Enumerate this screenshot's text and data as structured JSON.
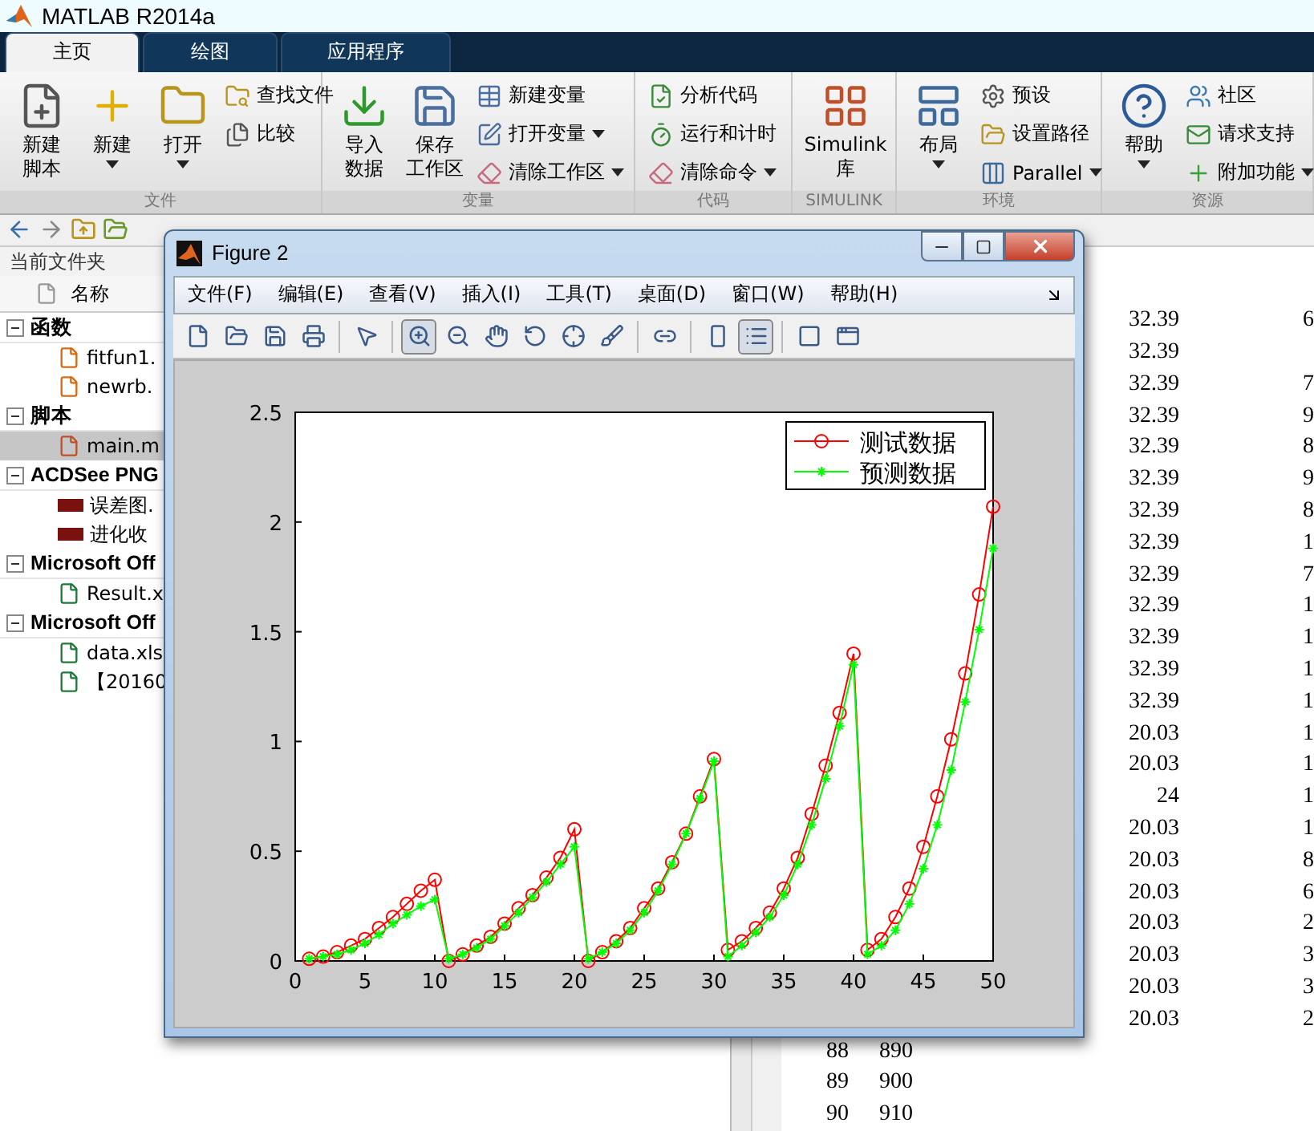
{
  "window": {
    "title": "MATLAB R2014a"
  },
  "tabs": [
    {
      "label": "主页",
      "selected": true
    },
    {
      "label": "绘图",
      "selected": false
    },
    {
      "label": "应用程序",
      "selected": false
    }
  ],
  "ribbon": [
    {
      "label": "文件",
      "items": [
        {
          "kind": "large",
          "lines": [
            "新建",
            "脚本"
          ],
          "dropdown": false
        },
        {
          "kind": "large",
          "lines": [
            "新建"
          ],
          "dropdown": true
        },
        {
          "kind": "large",
          "lines": [
            "打开"
          ],
          "dropdown": true
        },
        {
          "kind": "small",
          "label": "查找文件",
          "dropdown": false
        },
        {
          "kind": "small",
          "label": "比较",
          "dropdown": false
        }
      ]
    },
    {
      "label": "变量",
      "items": [
        {
          "kind": "large",
          "lines": [
            "导入",
            "数据"
          ],
          "dropdown": false
        },
        {
          "kind": "large",
          "lines": [
            "保存",
            "工作区"
          ],
          "dropdown": false
        },
        {
          "kind": "small",
          "label": "新建变量",
          "dropdown": false
        },
        {
          "kind": "small",
          "label": "打开变量",
          "dropdown": true
        },
        {
          "kind": "small",
          "label": "清除工作区",
          "dropdown": true
        }
      ]
    },
    {
      "label": "代码",
      "items": [
        {
          "kind": "small",
          "label": "分析代码",
          "dropdown": false
        },
        {
          "kind": "small",
          "label": "运行和计时",
          "dropdown": false
        },
        {
          "kind": "small",
          "label": "清除命令",
          "dropdown": true
        }
      ]
    },
    {
      "label": "SIMULINK",
      "items": [
        {
          "kind": "large",
          "lines": [
            "Simulink",
            "库"
          ],
          "dropdown": false
        }
      ]
    },
    {
      "label": "环境",
      "items": [
        {
          "kind": "large",
          "lines": [
            "布局"
          ],
          "dropdown": true
        },
        {
          "kind": "small",
          "label": "预设",
          "dropdown": false
        },
        {
          "kind": "small",
          "label": "设置路径",
          "dropdown": false
        },
        {
          "kind": "small",
          "label": "Parallel",
          "dropdown": true
        }
      ]
    },
    {
      "label": "资源",
      "items": [
        {
          "kind": "large",
          "lines": [
            "帮助"
          ],
          "dropdown": true
        },
        {
          "kind": "small",
          "label": "社区",
          "dropdown": false
        },
        {
          "kind": "small",
          "label": "请求支持",
          "dropdown": false
        },
        {
          "kind": "small",
          "label": "附加功能",
          "dropdown": true
        }
      ]
    }
  ],
  "browser": {
    "title": "当前文件夹",
    "column": "名称",
    "groups": [
      {
        "label": "函数",
        "expanded": true,
        "files": [
          {
            "name": "fitfun1.",
            "kind": "function",
            "selected": false
          },
          {
            "name": "newrb.",
            "kind": "function",
            "selected": false
          }
        ]
      },
      {
        "label": "脚本",
        "expanded": true,
        "files": [
          {
            "name": "main.m",
            "kind": "script",
            "selected": true
          }
        ]
      },
      {
        "label": "ACDSee PNG",
        "expanded": true,
        "files": [
          {
            "name": "误差图.",
            "kind": "png",
            "selected": false
          },
          {
            "name": "进化收",
            "kind": "png",
            "selected": false
          }
        ]
      },
      {
        "label": "Microsoft Off",
        "expanded": true,
        "files": [
          {
            "name": "Result.x",
            "kind": "excel",
            "selected": false
          }
        ]
      },
      {
        "label": "Microsoft Off",
        "expanded": true,
        "files": [
          {
            "name": "data.xls",
            "kind": "excel",
            "selected": false
          },
          {
            "name": "【20160",
            "kind": "excel",
            "selected": false
          }
        ]
      }
    ]
  },
  "table": {
    "rows": [
      {
        "cells": [
          null,
          null,
          "32.39",
          "6"
        ]
      },
      {
        "cells": [
          null,
          null,
          "32.39",
          null
        ]
      },
      {
        "cells": [
          null,
          null,
          "32.39",
          "7"
        ]
      },
      {
        "cells": [
          null,
          null,
          "32.39",
          "9"
        ]
      },
      {
        "cells": [
          null,
          null,
          "32.39",
          "8"
        ]
      },
      {
        "cells": [
          null,
          null,
          "32.39",
          "9"
        ]
      },
      {
        "cells": [
          null,
          null,
          "32.39",
          "8"
        ]
      },
      {
        "cells": [
          null,
          null,
          "32.39",
          "1"
        ]
      },
      {
        "cells": [
          null,
          null,
          "32.39",
          "7"
        ]
      },
      {
        "cells": [
          null,
          null,
          "32.39",
          "1"
        ]
      },
      {
        "cells": [
          null,
          null,
          "32.39",
          "1"
        ]
      },
      {
        "cells": [
          null,
          null,
          "32.39",
          "1"
        ]
      },
      {
        "cells": [
          null,
          null,
          "32.39",
          "1"
        ]
      },
      {
        "cells": [
          null,
          null,
          "20.03",
          "1"
        ]
      },
      {
        "cells": [
          null,
          null,
          "20.03",
          "1"
        ]
      },
      {
        "cells": [
          null,
          null,
          "24",
          "1"
        ]
      },
      {
        "cells": [
          null,
          null,
          "20.03",
          "1"
        ]
      },
      {
        "cells": [
          null,
          null,
          "20.03",
          "8"
        ]
      },
      {
        "cells": [
          null,
          null,
          "20.03",
          "6"
        ]
      },
      {
        "cells": [
          null,
          null,
          "20.03",
          "2"
        ]
      },
      {
        "cells": [
          null,
          null,
          "20.03",
          "3"
        ]
      },
      {
        "cells": [
          null,
          null,
          "20.03",
          "3"
        ]
      },
      {
        "cells": [
          null,
          null,
          "20.03",
          "2"
        ]
      },
      {
        "cells": [
          "88",
          "890",
          null,
          null
        ]
      },
      {
        "cells": [
          "89",
          "900",
          null,
          null
        ]
      },
      {
        "cells": [
          "90",
          "910",
          null,
          null
        ]
      }
    ]
  },
  "figure": {
    "title": "Figure 2",
    "menu": [
      "文件(F)",
      "编辑(E)",
      "查看(V)",
      "插入(I)",
      "工具(T)",
      "桌面(D)",
      "窗口(W)",
      "帮助(H)"
    ],
    "toolbar": [
      {
        "pressed": false
      },
      {
        "pressed": false
      },
      {
        "pressed": false
      },
      {
        "pressed": false
      },
      {
        "pressed": false
      },
      {
        "pressed": true
      },
      {
        "pressed": false
      },
      {
        "pressed": false
      },
      {
        "pressed": false
      },
      {
        "pressed": false
      },
      {
        "pressed": false
      },
      {
        "pressed": false
      },
      {
        "pressed": false
      },
      {
        "pressed": true
      },
      {
        "pressed": false
      },
      {
        "pressed": false
      }
    ],
    "chart_data": {
      "type": "line",
      "x": [
        1,
        2,
        3,
        4,
        5,
        6,
        7,
        8,
        9,
        10,
        11,
        12,
        13,
        14,
        15,
        16,
        17,
        18,
        19,
        20,
        21,
        22,
        23,
        24,
        25,
        26,
        27,
        28,
        29,
        30,
        31,
        32,
        33,
        34,
        35,
        36,
        37,
        38,
        39,
        40,
        41,
        42,
        43,
        44,
        45,
        46,
        47,
        48,
        49,
        50
      ],
      "series": [
        {
          "name": "测试数据",
          "color": "#ff0000",
          "marker": "circle",
          "values": [
            0.01,
            0.02,
            0.04,
            0.07,
            0.1,
            0.15,
            0.2,
            0.26,
            0.32,
            0.37,
            0,
            0.03,
            0.07,
            0.11,
            0.17,
            0.24,
            0.3,
            0.38,
            0.47,
            0.6,
            0,
            0.04,
            0.09,
            0.15,
            0.24,
            0.33,
            0.45,
            0.58,
            0.75,
            0.92,
            0.05,
            0.09,
            0.15,
            0.22,
            0.33,
            0.47,
            0.67,
            0.89,
            1.13,
            1.4,
            0.05,
            0.1,
            0.2,
            0.33,
            0.52,
            0.75,
            1.01,
            1.31,
            1.67,
            2.07
          ]
        },
        {
          "name": "预测数据",
          "color": "#00ff00",
          "marker": "cross",
          "values": [
            0.01,
            0.02,
            0.03,
            0.05,
            0.08,
            0.12,
            0.17,
            0.21,
            0.25,
            0.28,
            0.01,
            0.03,
            0.06,
            0.1,
            0.16,
            0.22,
            0.29,
            0.36,
            0.44,
            0.52,
            0.01,
            0.04,
            0.08,
            0.14,
            0.22,
            0.32,
            0.44,
            0.58,
            0.74,
            0.91,
            0.02,
            0.07,
            0.13,
            0.2,
            0.3,
            0.44,
            0.62,
            0.83,
            1.07,
            1.35,
            0.03,
            0.07,
            0.14,
            0.26,
            0.42,
            0.62,
            0.87,
            1.18,
            1.51,
            1.88
          ]
        }
      ],
      "legend": true,
      "xlim": [
        0,
        50
      ],
      "ylim": [
        0,
        2.5
      ],
      "xticks": [
        0,
        5,
        10,
        15,
        20,
        25,
        30,
        35,
        40,
        45,
        50
      ],
      "yticks": [
        0,
        0.5,
        1,
        1.5,
        2,
        2.5
      ]
    }
  }
}
